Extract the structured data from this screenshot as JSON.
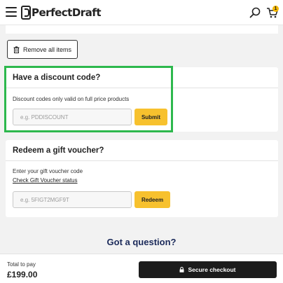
{
  "header": {
    "logo_text": "PerfectDraft",
    "cart_count": "1",
    "icons": [
      "hamburger-menu-icon",
      "search-icon",
      "cart-icon"
    ]
  },
  "cart": {
    "remove_all_label": "Remove all items"
  },
  "discount": {
    "title": "Have a discount code?",
    "note": "Discount codes only valid on full price products",
    "placeholder": "e.g. PDDISCOUNT",
    "submit_label": "Submit"
  },
  "voucher": {
    "title": "Redeem a gift voucher?",
    "prompt": "Enter your gift voucher code",
    "status_link": "Check Gift Voucher status",
    "placeholder": "e.g. 5FIGT2MGF9T",
    "redeem_label": "Redeem"
  },
  "help": {
    "title": "Got a question?"
  },
  "footer": {
    "total_label": "Total to pay",
    "total_value": "£199.00",
    "checkout_label": "Secure checkout"
  },
  "colors": {
    "accent_yellow": "#f7c12e",
    "highlight_green": "#2db84d",
    "heading_navy": "#1b2a5a",
    "checkout_black": "#1c1c1c"
  }
}
